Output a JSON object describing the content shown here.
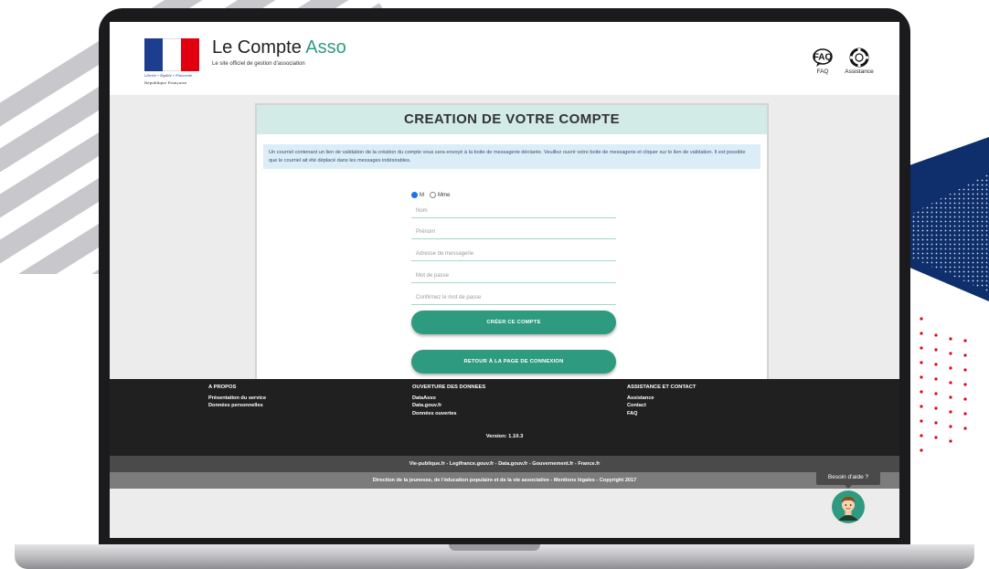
{
  "header": {
    "motto": "Liberté • Égalité • Fraternité",
    "republic": "République Française",
    "app_title_main": "Le Compte ",
    "app_title_accent": "Asso",
    "app_subtitle": "Le site officiel de gestion d'association",
    "faq_icon_text": "FAQ",
    "faq_label": "FAQ",
    "assistance_label": "Assistance"
  },
  "form": {
    "heading": "CREATION DE VOTRE COMPTE",
    "info_text": "Un courriel contenant un lien de validation de la création du compte vous sera envoyé à la boite de messagerie déclarée. Veuillez ouvrir votre boite de messagerie et cliquer sur le lien de validation. Il est possible que le courriel ait été déplacé dans les messages indésirables.",
    "civility_options": [
      "M",
      "Mme"
    ],
    "civility_selected": "M",
    "fields": {
      "nom": "Nom",
      "prenom": "Prénom",
      "email": "Adresse de messagerie",
      "password": "Mot de passe",
      "confirm": "Confirmez le mot de passe"
    },
    "create_button": "CRÉER CE COMPTE",
    "back_button": "RETOUR À LA PAGE DE CONNEXION"
  },
  "footer": {
    "col1": {
      "title": "A PROPOS",
      "items": [
        "Présentation du service",
        "Données personnelles"
      ]
    },
    "col2": {
      "title": "OUVERTURE DES DONNEES",
      "items": [
        "DataAsso",
        "Data.gouv.fr",
        "Données ouvertes"
      ]
    },
    "col3": {
      "title": "ASSISTANCE ET CONTACT",
      "items": [
        "Assistance",
        "Contact",
        "FAQ"
      ]
    },
    "version": "Version: 1.10.3",
    "links_bar": "Vie-publique.fr - Legifrance.gouv.fr - Data.gouv.fr - Gouvernement.fr - France.fr",
    "credit_bar": "Direction de la jeunesse, de l'éducation populaire et de la vie associative - Mentions légales - Copyright 2017"
  },
  "help": {
    "label": "Besoin d'aide ?"
  },
  "colors": {
    "brand_green": "#2e9b80",
    "header_band": "#d2ebe7",
    "info_band": "#dbeef7",
    "footer_dark": "#202020"
  },
  "icons": [
    "faq-icon",
    "lifebuoy-icon",
    "help-avatar-icon"
  ]
}
